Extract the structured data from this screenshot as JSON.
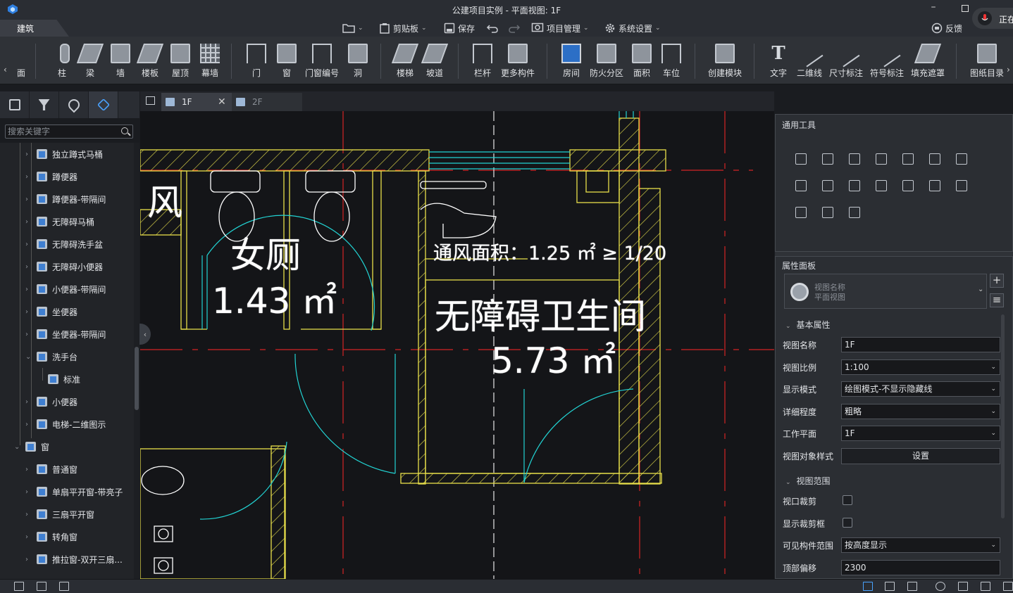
{
  "window": {
    "title": "公建项目实例 - 平面视图: 1F",
    "recording_label": "正在"
  },
  "menubar": {
    "active_tab": "建筑",
    "quick": [
      {
        "label": "",
        "icon": "folder-icon"
      },
      {
        "label": "剪贴板",
        "icon": "clipboard-icon"
      },
      {
        "label": "保存",
        "icon": "save-icon"
      },
      {
        "label": "",
        "icon": "undo-icon"
      },
      {
        "label": "",
        "icon": "redo-icon"
      },
      {
        "label": "项目管理",
        "icon": "project-gear-icon"
      },
      {
        "label": "系统设置",
        "icon": "gear-icon"
      }
    ],
    "feedback_label": "反馈"
  },
  "ribbon": {
    "left_cut": "面",
    "groups": [
      [
        "柱",
        "梁",
        "墙",
        "楼板",
        "屋顶",
        "幕墙"
      ],
      [
        "门",
        "窗",
        "门窗编号",
        "洞"
      ],
      [
        "楼梯",
        "坡道"
      ],
      [
        "栏杆",
        "更多构件"
      ],
      [
        "房间",
        "防火分区",
        "面积",
        "车位"
      ],
      [
        "创建模块"
      ],
      [
        "文字",
        "二维线",
        "尺寸标注",
        "符号标注",
        "填充遮罩"
      ],
      [
        "图纸目录"
      ]
    ]
  },
  "left_panel": {
    "search_placeholder": "搜索关键字",
    "tree": [
      {
        "label": "独立蹲式马桶",
        "level": 2,
        "expanded": false
      },
      {
        "label": "蹲便器",
        "level": 2,
        "expanded": false
      },
      {
        "label": "蹲便器-带隔间",
        "level": 2,
        "expanded": false
      },
      {
        "label": "无障碍马桶",
        "level": 2,
        "expanded": false
      },
      {
        "label": "无障碍洗手盆",
        "level": 2,
        "expanded": false
      },
      {
        "label": "无障碍小便器",
        "level": 2,
        "expanded": false
      },
      {
        "label": "小便器-带隔间",
        "level": 2,
        "expanded": false
      },
      {
        "label": "坐便器",
        "level": 2,
        "expanded": false
      },
      {
        "label": "坐便器-带隔间",
        "level": 2,
        "expanded": false
      },
      {
        "label": "洗手台",
        "level": 2,
        "expanded": true
      },
      {
        "label": "标准",
        "level": 3,
        "expanded": null
      },
      {
        "label": "小便器",
        "level": 2,
        "expanded": false
      },
      {
        "label": "电梯-二维图示",
        "level": 2,
        "expanded": false
      },
      {
        "label": "窗",
        "level": 1,
        "expanded": true
      },
      {
        "label": "普通窗",
        "level": 2,
        "expanded": false
      },
      {
        "label": "单扇平开窗-带亮子",
        "level": 2,
        "expanded": false
      },
      {
        "label": "三扇平开窗",
        "level": 2,
        "expanded": false
      },
      {
        "label": "转角窗",
        "level": 2,
        "expanded": false
      },
      {
        "label": "推拉窗-双开三扇...",
        "level": 2,
        "expanded": false
      }
    ]
  },
  "doc_tabs": [
    {
      "label": "1F",
      "active": true
    },
    {
      "label": "2F",
      "active": false
    }
  ],
  "canvas": {
    "rooms": [
      {
        "id": "cut",
        "text": "风"
      },
      {
        "id": "female",
        "name": "女厕",
        "area": "1.43 ㎡"
      },
      {
        "id": "vent",
        "text": "通风面积：1.25 ㎡ ≥ 1/20"
      },
      {
        "id": "accessible",
        "name": "无障碍卫生间",
        "area": "5.73 ㎡"
      }
    ]
  },
  "right_panel": {
    "tools_title": "通用工具",
    "tools": [
      "move",
      "copy",
      "rotate",
      "align",
      "split",
      "offset",
      "duplicate",
      "stack",
      "trim",
      "extend",
      "array",
      "group",
      "mirror",
      "delete",
      "3d-view",
      "attach",
      "measure"
    ],
    "props_title": "属性面板",
    "view_card": {
      "name_placeholder": "视图名称",
      "type": "平面视图"
    },
    "group_basic": "基本属性",
    "props": [
      {
        "label": "视图名称",
        "value": "1F",
        "kind": "text"
      },
      {
        "label": "视图比例",
        "value": "1:100",
        "kind": "select"
      },
      {
        "label": "显示模式",
        "value": "绘图模式-不显示隐藏线",
        "kind": "select"
      },
      {
        "label": "详细程度",
        "value": "粗略",
        "kind": "select"
      },
      {
        "label": "工作平面",
        "value": "1F",
        "kind": "select"
      },
      {
        "label": "视图对象样式",
        "value": "设置",
        "kind": "button"
      }
    ],
    "group_range": "视图范围",
    "range_props": [
      {
        "label": "视口裁剪",
        "kind": "checkbox",
        "checked": false
      },
      {
        "label": "显示裁剪框",
        "kind": "checkbox",
        "checked": false
      },
      {
        "label": "可见构件范围",
        "value": "按高度显示",
        "kind": "select"
      },
      {
        "label": "顶部偏移",
        "value": "2300",
        "kind": "text"
      }
    ]
  },
  "colors": {
    "accent": "#4aa3ff",
    "wall": "#e8e04a",
    "axis": "#d42424",
    "door": "#22d3d3"
  }
}
